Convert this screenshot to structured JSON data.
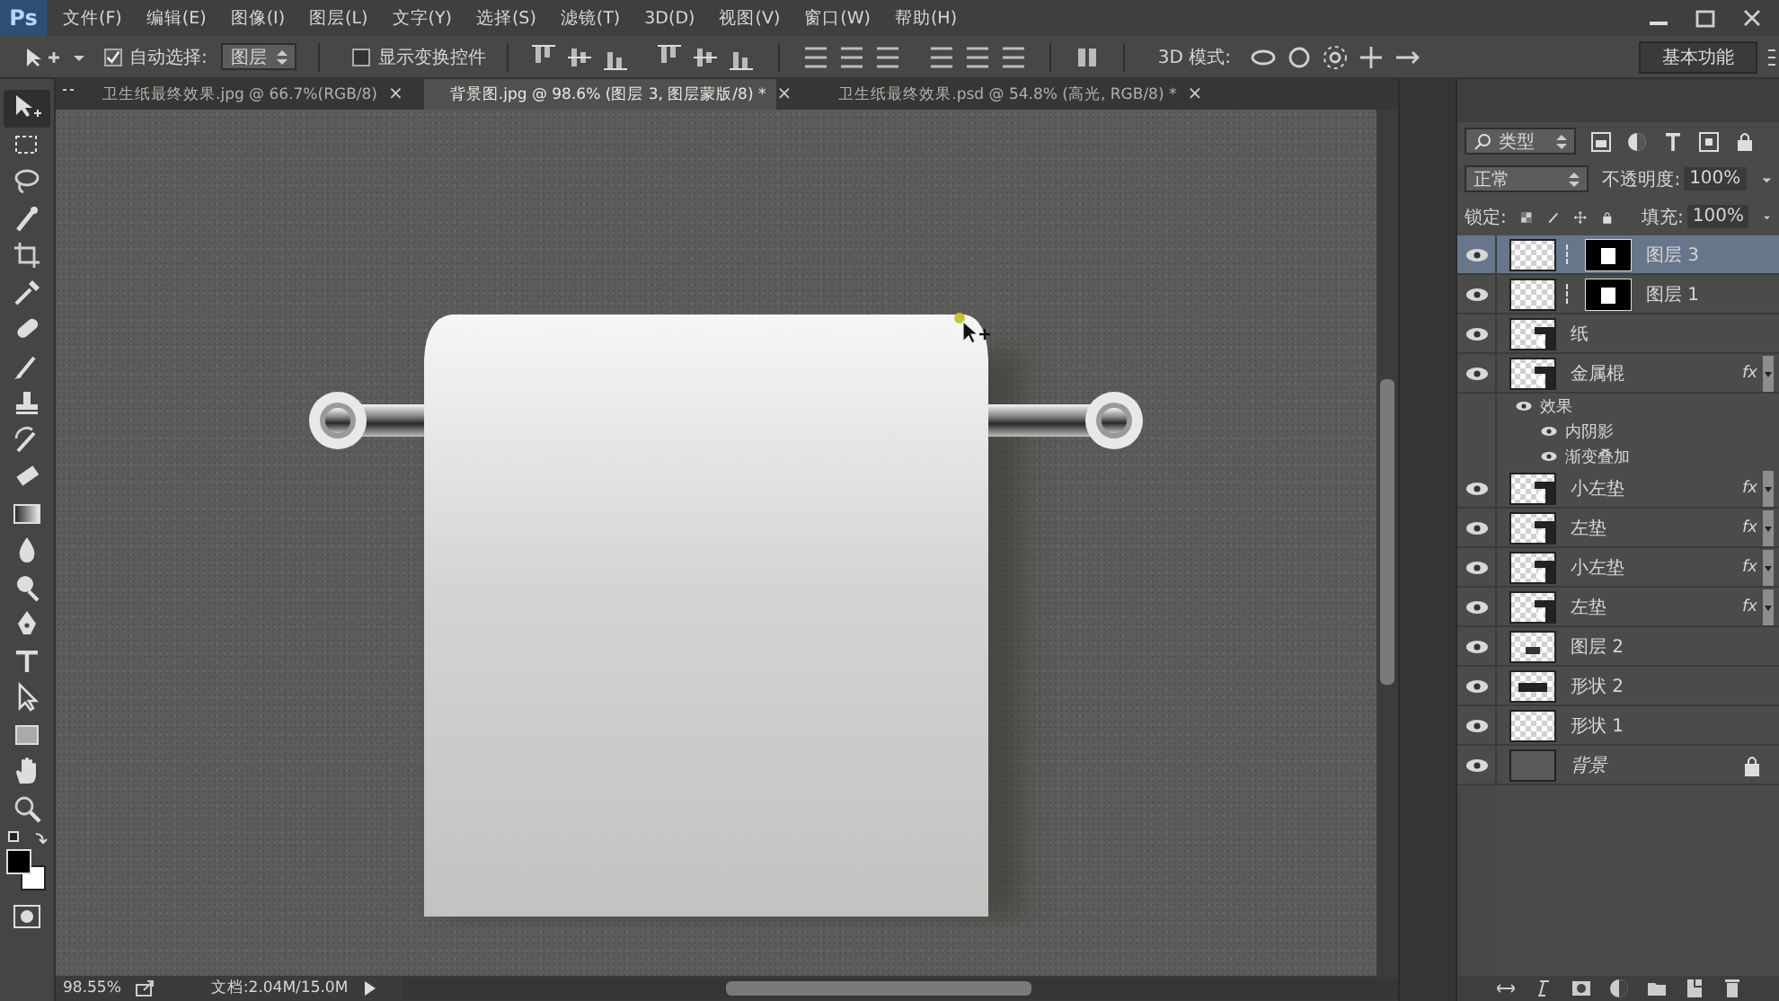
{
  "app": {
    "logo": "Ps"
  },
  "menu": [
    {
      "label": "文件(F)"
    },
    {
      "label": "编辑(E)"
    },
    {
      "label": "图像(I)"
    },
    {
      "label": "图层(L)"
    },
    {
      "label": "文字(Y)"
    },
    {
      "label": "选择(S)"
    },
    {
      "label": "滤镜(T)"
    },
    {
      "label": "3D(D)"
    },
    {
      "label": "视图(V)"
    },
    {
      "label": "窗口(W)"
    },
    {
      "label": "帮助(H)"
    }
  ],
  "options": {
    "auto_select": {
      "label": "自动选择:",
      "checked": true
    },
    "target": "图层",
    "show_transform": {
      "label": "显示变换控件",
      "checked": false
    },
    "mode_3d_label": "3D 模式:",
    "workspace": "基本功能"
  },
  "tabs": [
    {
      "label": "卫生纸最终效果.jpg @ 66.7%(RGB/8)",
      "close": "×",
      "selected": false
    },
    {
      "label": "背景图.jpg @ 98.6% (图层 3, 图层蒙版/8) *",
      "close": "×",
      "selected": true
    },
    {
      "label": "卫生纸最终效果.psd @ 54.8% (高光, RGB/8) *",
      "close": "×",
      "selected": false
    }
  ],
  "tools": [
    {
      "kind": "move",
      "selected": true
    },
    {
      "kind": "marquee",
      "selected": false
    },
    {
      "kind": "lasso",
      "selected": false
    },
    {
      "kind": "quick-select",
      "selected": false
    },
    {
      "kind": "crop",
      "selected": false
    },
    {
      "kind": "eyedropper",
      "selected": false
    },
    {
      "kind": "healing",
      "selected": false
    },
    {
      "kind": "brush",
      "selected": false
    },
    {
      "kind": "stamp",
      "selected": false
    },
    {
      "kind": "history",
      "selected": false
    },
    {
      "kind": "eraser",
      "selected": false
    },
    {
      "kind": "gradient",
      "selected": false
    },
    {
      "kind": "blur",
      "selected": false
    },
    {
      "kind": "dodge",
      "selected": false
    },
    {
      "kind": "pen",
      "selected": false
    },
    {
      "kind": "type",
      "selected": false
    },
    {
      "kind": "path-select",
      "selected": false
    },
    {
      "kind": "rectangle",
      "selected": false
    },
    {
      "kind": "hand",
      "selected": false
    },
    {
      "kind": "zoom",
      "selected": false
    }
  ],
  "layers_panel": {
    "filter": "类型",
    "blend_mode": "正常",
    "opacity_label": "不透明度:",
    "opacity": "100%",
    "lock_label": "锁定:",
    "fill_label": "填充:",
    "fill": "100%",
    "layers": [
      {
        "name": "图层 3",
        "kind": "masked",
        "visible": true,
        "selected": true,
        "locked": false
      },
      {
        "name": "图层 1",
        "kind": "masked",
        "visible": true,
        "selected": false,
        "locked": false
      },
      {
        "name": "纸",
        "kind": "shape",
        "visible": true,
        "selected": false,
        "locked": false
      },
      {
        "name": "金属棍",
        "kind": "shape",
        "visible": true,
        "selected": false,
        "locked": false,
        "fx": "fx",
        "children": [
          {
            "name": "效果",
            "visible": true,
            "children": [
              {
                "name": "内阴影",
                "visible": true
              },
              {
                "name": "渐变叠加",
                "visible": true
              }
            ]
          }
        ]
      },
      {
        "name": "小左垫",
        "kind": "shape",
        "visible": true,
        "selected": false,
        "locked": false,
        "fx": "fx"
      },
      {
        "name": "左垫",
        "kind": "shape",
        "visible": true,
        "selected": false,
        "locked": false,
        "fx": "fx"
      },
      {
        "name": "小左垫",
        "kind": "shape",
        "visible": true,
        "selected": false,
        "locked": false,
        "fx": "fx"
      },
      {
        "name": "左垫",
        "kind": "shape",
        "visible": true,
        "selected": false,
        "locked": false,
        "fx": "fx"
      },
      {
        "name": "图层 2",
        "kind": "image",
        "visible": true,
        "selected": false,
        "locked": false
      },
      {
        "name": "形状 2",
        "kind": "bar",
        "visible": true,
        "selected": false,
        "locked": false
      },
      {
        "name": "形状 1",
        "kind": "empty",
        "visible": true,
        "selected": false,
        "locked": false
      },
      {
        "name": "背景",
        "kind": "background",
        "visible": true,
        "selected": false,
        "locked": true
      }
    ]
  },
  "status_bar": {
    "zoom": "98.55%",
    "document": "文档:2.04M/15.0M"
  }
}
